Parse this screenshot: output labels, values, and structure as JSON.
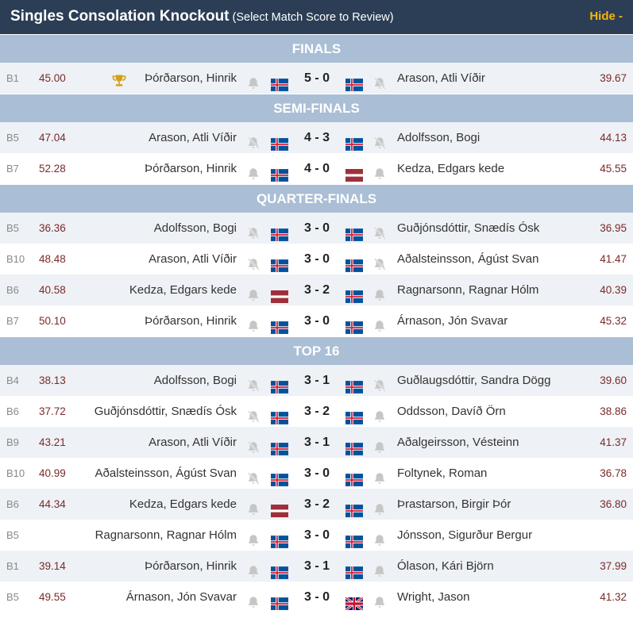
{
  "header": {
    "title": "Singles Consolation Knockout",
    "subtitle": "(Select Match Score to Review)",
    "hide_label": "Hide -"
  },
  "colors": {
    "header_bg": "#2b3e55",
    "section_bg": "#aabed5",
    "hide_link": "#f6b40e",
    "average": "#7a2a2a"
  },
  "sections": [
    {
      "title": "FINALS",
      "matches": [
        {
          "board": "B1",
          "avg1": "45.00",
          "player1": "Þórðarson, Hinrik",
          "trophy": true,
          "flag1": "iceland",
          "score": "5 - 0",
          "flag2": "iceland",
          "player2": "Arason, Atli Víðir",
          "avg2": "39.67",
          "bell1": "on",
          "bell2": "off"
        }
      ]
    },
    {
      "title": "SEMI-FINALS",
      "matches": [
        {
          "board": "B5",
          "avg1": "47.04",
          "player1": "Arason, Atli Víðir",
          "flag1": "iceland",
          "score": "4 - 3",
          "flag2": "iceland",
          "player2": "Adolfsson, Bogi",
          "avg2": "44.13",
          "bell1": "off",
          "bell2": "off"
        },
        {
          "board": "B7",
          "avg1": "52.28",
          "player1": "Þórðarson, Hinrik",
          "flag1": "iceland",
          "score": "4 - 0",
          "flag2": "latvia",
          "player2": "Kedza, Edgars kede",
          "avg2": "45.55",
          "bell1": "on",
          "bell2": "on"
        }
      ]
    },
    {
      "title": "QUARTER-FINALS",
      "matches": [
        {
          "board": "B5",
          "avg1": "36.36",
          "player1": "Adolfsson, Bogi",
          "flag1": "iceland",
          "score": "3 - 0",
          "flag2": "iceland",
          "player2": "Guðjónsdóttir, Snædís Ósk",
          "avg2": "36.95",
          "bell1": "off",
          "bell2": "off"
        },
        {
          "board": "B10",
          "avg1": "48.48",
          "player1": "Arason, Atli Víðir",
          "flag1": "iceland",
          "score": "3 - 0",
          "flag2": "iceland",
          "player2": "Aðalsteinsson, Ágúst Svan",
          "avg2": "41.47",
          "bell1": "off",
          "bell2": "off"
        },
        {
          "board": "B6",
          "avg1": "40.58",
          "player1": "Kedza, Edgars kede",
          "flag1": "latvia",
          "score": "3 - 2",
          "flag2": "iceland",
          "player2": "Ragnarsonn, Ragnar Hólm",
          "avg2": "40.39",
          "bell1": "on",
          "bell2": "on"
        },
        {
          "board": "B7",
          "avg1": "50.10",
          "player1": "Þórðarson, Hinrik",
          "flag1": "iceland",
          "score": "3 - 0",
          "flag2": "iceland",
          "player2": "Árnason, Jón Svavar",
          "avg2": "45.32",
          "bell1": "on",
          "bell2": "on"
        }
      ]
    },
    {
      "title": "TOP 16",
      "matches": [
        {
          "board": "B4",
          "avg1": "38.13",
          "player1": "Adolfsson, Bogi",
          "flag1": "iceland",
          "score": "3 - 1",
          "flag2": "iceland",
          "player2": "Guðlaugsdóttir, Sandra Dögg",
          "avg2": "39.60",
          "bell1": "off",
          "bell2": "off"
        },
        {
          "board": "B6",
          "avg1": "37.72",
          "player1": "Guðjónsdóttir, Snædís Ósk",
          "flag1": "iceland",
          "score": "3 - 2",
          "flag2": "iceland",
          "player2": "Oddsson, Davíð Örn",
          "avg2": "38.86",
          "bell1": "off",
          "bell2": "on"
        },
        {
          "board": "B9",
          "avg1": "43.21",
          "player1": "Arason, Atli Víðir",
          "flag1": "iceland",
          "score": "3 - 1",
          "flag2": "iceland",
          "player2": "Aðalgeirsson, Vésteinn",
          "avg2": "41.37",
          "bell1": "off",
          "bell2": "on"
        },
        {
          "board": "B10",
          "avg1": "40.99",
          "player1": "Aðalsteinsson, Ágúst Svan",
          "flag1": "iceland",
          "score": "3 - 0",
          "flag2": "iceland",
          "player2": "Foltynek, Roman",
          "avg2": "36.78",
          "bell1": "off",
          "bell2": "on"
        },
        {
          "board": "B6",
          "avg1": "44.34",
          "player1": "Kedza, Edgars kede",
          "flag1": "latvia",
          "score": "3 - 2",
          "flag2": "iceland",
          "player2": "Þrastarson, Birgir Þór",
          "avg2": "36.80",
          "bell1": "on",
          "bell2": "on"
        },
        {
          "board": "B5",
          "avg1": "",
          "player1": "Ragnarsonn, Ragnar Hólm",
          "flag1": "iceland",
          "score": "3 - 0",
          "flag2": "iceland",
          "player2": "Jónsson, Sigurður Bergur",
          "avg2": "",
          "bell1": "on",
          "bell2": "on"
        },
        {
          "board": "B1",
          "avg1": "39.14",
          "player1": "Þórðarson, Hinrik",
          "flag1": "iceland",
          "score": "3 - 1",
          "flag2": "iceland",
          "player2": "Ólason, Kári Björn",
          "avg2": "37.99",
          "bell1": "on",
          "bell2": "on"
        },
        {
          "board": "B5",
          "avg1": "49.55",
          "player1": "Árnason, Jón Svavar",
          "flag1": "iceland",
          "score": "3 - 0",
          "flag2": "uk",
          "player2": "Wright, Jason",
          "avg2": "41.32",
          "bell1": "on",
          "bell2": "on"
        }
      ]
    }
  ]
}
